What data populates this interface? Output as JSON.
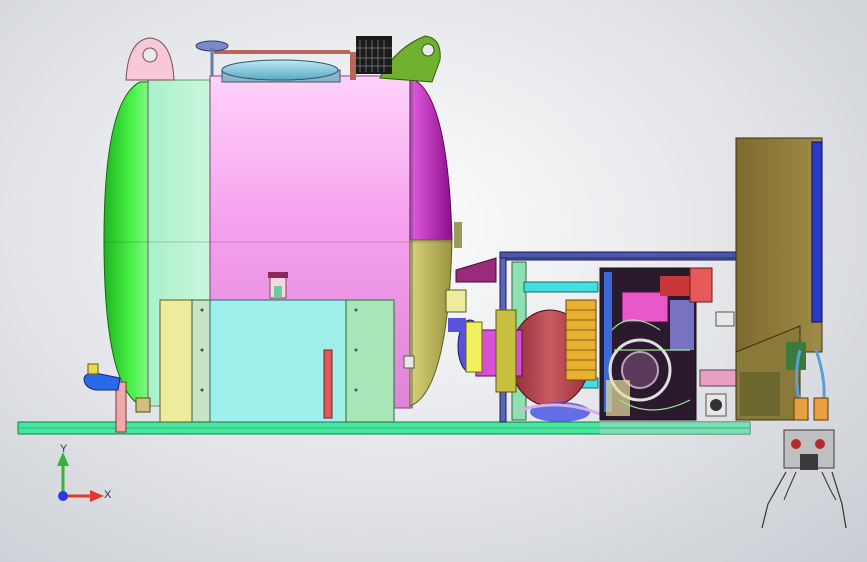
{
  "view": {
    "triad": {
      "y_label": "Y",
      "x_label": "X",
      "y_color": "#38b23a",
      "x_color": "#e23a2a",
      "z_color": "#2a3ae2"
    }
  },
  "colors": {
    "tank_pink": "#f7a6f0",
    "tank_green": "#2ee62e",
    "tank_purple": "#b21ab2",
    "tank_olive": "#c9c26a",
    "base_green": "#3ee89a",
    "cyan_box": "#8fe8e6",
    "cabinet_olive": "#8a7a3a",
    "frame_blue": "#4b57a8",
    "pump_red": "#b8454d"
  }
}
